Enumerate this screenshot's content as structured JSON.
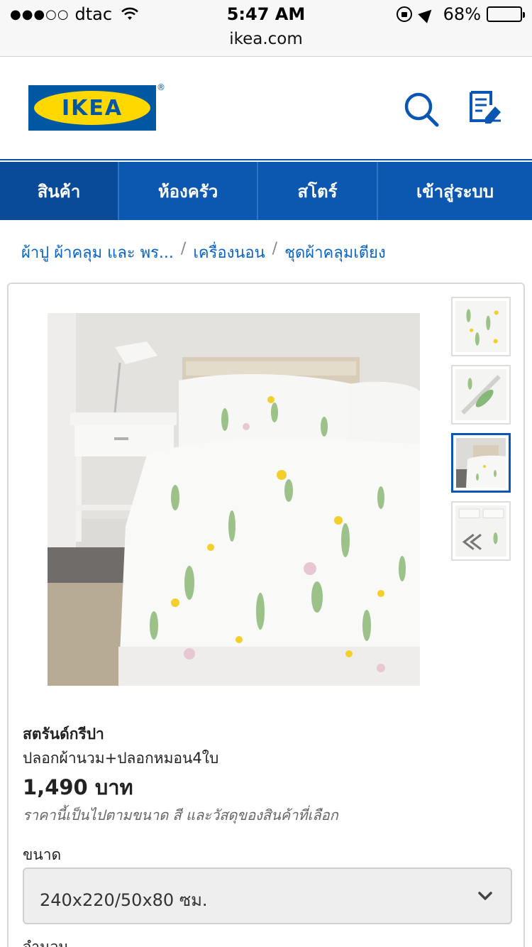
{
  "status_bar": {
    "signal": "●●●○○",
    "carrier": "dtac",
    "time": "5:47 AM",
    "battery": "68%",
    "battery_level": 0.68
  },
  "browser": {
    "url": "ikea.com"
  },
  "header": {
    "logo_text": "IKEA",
    "logo_mark": "®",
    "brand_colors": {
      "blue": "#0058a3",
      "yellow": "#ffd800"
    }
  },
  "nav": {
    "items": [
      {
        "label": "สินค้า"
      },
      {
        "label": "ห้องครัว"
      },
      {
        "label": "สโตร์"
      },
      {
        "label": "เข้าสู่ระบบ"
      }
    ]
  },
  "breadcrumb": {
    "items": [
      {
        "label": "ผ้าปู ผ้าคลุม และ พร..."
      },
      {
        "label": "เครื่องนอน"
      },
      {
        "label": "ชุดผ้าคลุมเตียง"
      }
    ],
    "separator": "/"
  },
  "product": {
    "name": "สตรันด์กรีปา",
    "description": "ปลอกผ้านวม+ปลอกหมอน4ใบ",
    "price": "1,490 บาท",
    "price_note": "ราคานี้เป็นไปตามขนาด สี และวัสดุของสินค้าที่เลือก",
    "size_label": "ขนาด",
    "size_value": "240x220/50x80 ซม.",
    "quantity_label": "จำนวน",
    "thumbnails": [
      {
        "icon": "floral-fabric-thumbnail"
      },
      {
        "icon": "fabric-detail-thumbnail"
      },
      {
        "icon": "bedroom-thumbnail",
        "selected": true
      },
      {
        "icon": "folded-set-thumbnail"
      }
    ]
  }
}
